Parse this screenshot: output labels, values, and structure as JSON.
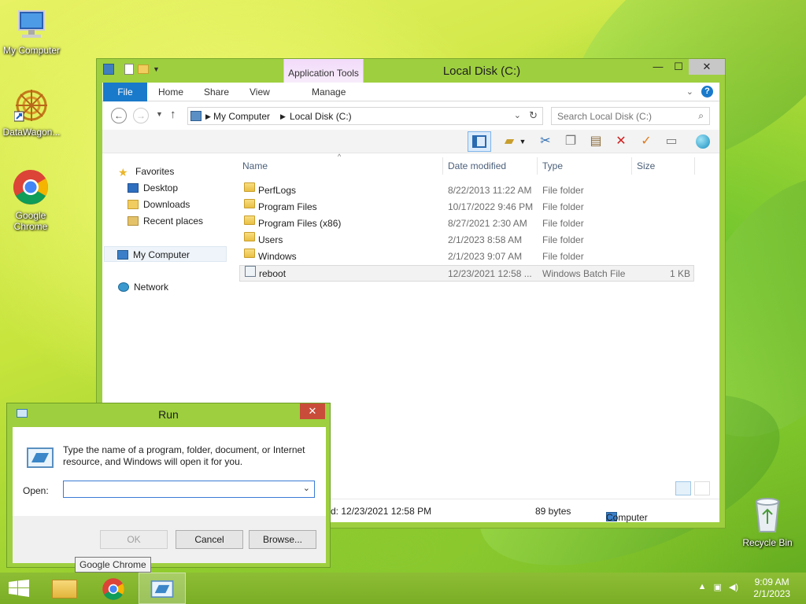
{
  "desktop": {
    "icons": [
      {
        "label": "My Computer"
      },
      {
        "label": "DataWagon..."
      },
      {
        "label": "Google Chrome"
      },
      {
        "label": "Recycle Bin"
      }
    ]
  },
  "explorer": {
    "title": "Local Disk (C:)",
    "context_tab_group": "Application Tools",
    "tabs": [
      "File",
      "Home",
      "Share",
      "View",
      "Manage"
    ],
    "address": {
      "root": "My Computer",
      "current": "Local Disk (C:)"
    },
    "search_placeholder": "Search Local Disk (C:)",
    "nav": {
      "favorites": "Favorites",
      "favorite_items": [
        "Desktop",
        "Downloads",
        "Recent places"
      ],
      "computer": "My Computer",
      "network": "Network"
    },
    "columns": [
      "Name",
      "Date modified",
      "Type",
      "Size"
    ],
    "files": [
      {
        "name": "PerfLogs",
        "date": "8/22/2013 11:22 AM",
        "type": "File folder",
        "size": ""
      },
      {
        "name": "Program Files",
        "date": "10/17/2022 9:46 PM",
        "type": "File folder",
        "size": ""
      },
      {
        "name": "Program Files (x86)",
        "date": "8/27/2021 2:30 AM",
        "type": "File folder",
        "size": ""
      },
      {
        "name": "Users",
        "date": "2/1/2023 8:58 AM",
        "type": "File folder",
        "size": ""
      },
      {
        "name": "Windows",
        "date": "2/1/2023 9:07 AM",
        "type": "File folder",
        "size": ""
      },
      {
        "name": "reboot",
        "date": "12/23/2021 12:58 ...",
        "type": "Windows Batch File",
        "size": "1 KB"
      }
    ],
    "status": {
      "date": "d: 12/23/2021 12:58 PM",
      "size": "89 bytes",
      "location": "Computer"
    }
  },
  "run_dialog": {
    "title": "Run",
    "message": "Type the name of a program, folder, document, or Internet resource, and Windows will open it for you.",
    "open_label": "Open:",
    "open_value": "",
    "ok": "OK",
    "cancel": "Cancel",
    "browse": "Browse..."
  },
  "tooltip": "Google Chrome",
  "taskbar": {
    "time": "9:09 AM",
    "date": "2/1/2023"
  }
}
